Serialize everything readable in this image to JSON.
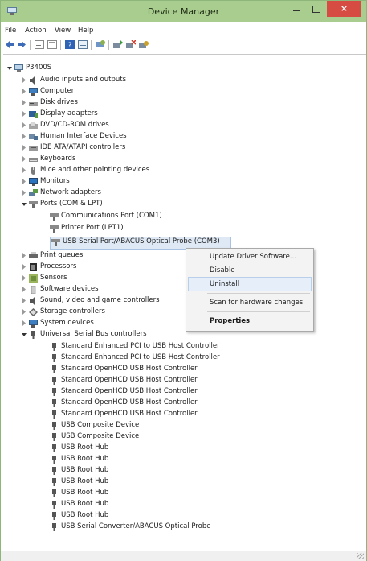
{
  "window": {
    "title": "Device Manager",
    "close_glyph": "×"
  },
  "menu": {
    "file": "File",
    "action": "Action",
    "view": "View",
    "help": "Help"
  },
  "tree": {
    "root": "P3400S",
    "categories": {
      "audio": "Audio inputs and outputs",
      "computer": "Computer",
      "disk": "Disk drives",
      "display": "Display adapters",
      "dvd": "DVD/CD-ROM drives",
      "hid": "Human Interface Devices",
      "ide": "IDE ATA/ATAPI controllers",
      "keyboards": "Keyboards",
      "mice": "Mice and other pointing devices",
      "monitors": "Monitors",
      "network": "Network adapters",
      "ports": "Ports (COM & LPT)",
      "print": "Print queues",
      "processors": "Processors",
      "sensors": "Sensors",
      "software": "Software devices",
      "sound": "Sound, video and game controllers",
      "storage": "Storage controllers",
      "system": "System devices",
      "usb": "Universal Serial Bus controllers"
    },
    "ports_children": {
      "com1": "Communications Port (COM1)",
      "lpt1": "Printer Port (LPT1)",
      "usb_serial": "USB Serial Port/ABACUS Optical Probe (COM3)"
    },
    "usb_children": [
      "Standard Enhanced PCI to USB Host Controller",
      "Standard Enhanced PCI to USB Host Controller",
      "Standard OpenHCD USB Host Controller",
      "Standard OpenHCD USB Host Controller",
      "Standard OpenHCD USB Host Controller",
      "Standard OpenHCD USB Host Controller",
      "Standard OpenHCD USB Host Controller",
      "USB Composite Device",
      "USB Composite Device",
      "USB Root Hub",
      "USB Root Hub",
      "USB Root Hub",
      "USB Root Hub",
      "USB Root Hub",
      "USB Root Hub",
      "USB Root Hub",
      "USB Serial Converter/ABACUS Optical Probe"
    ]
  },
  "context_menu": {
    "update": "Update Driver Software...",
    "disable": "Disable",
    "uninstall": "Uninstall",
    "scan": "Scan for hardware changes",
    "properties": "Properties"
  },
  "colors": {
    "titlebar": "#a9cd8e",
    "close_button": "#d64c42",
    "selection": "#dfe9f5",
    "menu_highlight": "#e6eefa"
  },
  "icons": {
    "app": "device-manager-icon",
    "back": "back-arrow-icon",
    "forward": "forward-arrow-icon",
    "usb": "usb-plug-icon",
    "port": "port-connector-icon"
  }
}
